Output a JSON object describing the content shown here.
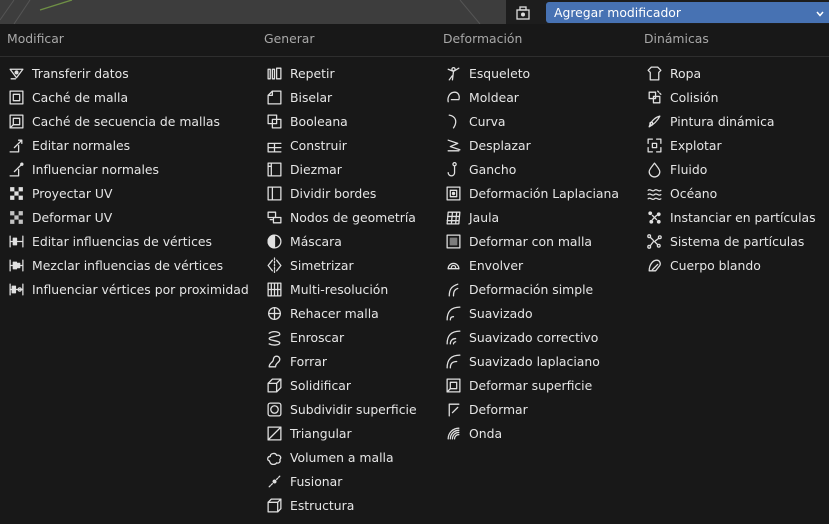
{
  "dropdown": {
    "label": "Agregar modificador"
  },
  "columns": [
    {
      "header": "Modificar",
      "items": [
        {
          "label": "Transferir datos",
          "icon": "transfer-data-icon"
        },
        {
          "label": "Caché de malla",
          "icon": "mesh-cache-icon"
        },
        {
          "label": "Caché de secuencia de mallas",
          "icon": "mesh-sequence-cache-icon"
        },
        {
          "label": "Editar normales",
          "icon": "normal-edit-icon"
        },
        {
          "label": "Influenciar normales",
          "icon": "weighted-normal-icon"
        },
        {
          "label": "Proyectar UV",
          "icon": "uv-project-icon"
        },
        {
          "label": "Deformar UV",
          "icon": "uv-warp-icon"
        },
        {
          "label": "Editar influencias de vértices",
          "icon": "vertex-weight-edit-icon"
        },
        {
          "label": "Mezclar influencias de vértices",
          "icon": "vertex-weight-mix-icon"
        },
        {
          "label": "Influenciar vértices por proximidad",
          "icon": "vertex-weight-proximity-icon"
        }
      ]
    },
    {
      "header": "Generar",
      "items": [
        {
          "label": "Repetir",
          "icon": "array-icon"
        },
        {
          "label": "Biselar",
          "icon": "bevel-icon"
        },
        {
          "label": "Booleana",
          "icon": "boolean-icon"
        },
        {
          "label": "Construir",
          "icon": "build-icon"
        },
        {
          "label": "Diezmar",
          "icon": "decimate-icon"
        },
        {
          "label": "Dividir bordes",
          "icon": "edge-split-icon"
        },
        {
          "label": "Nodos de geometría",
          "icon": "geometry-nodes-icon"
        },
        {
          "label": "Máscara",
          "icon": "mask-icon"
        },
        {
          "label": "Simetrizar",
          "icon": "mirror-icon"
        },
        {
          "label": "Multi-resolución",
          "icon": "multires-icon"
        },
        {
          "label": "Rehacer malla",
          "icon": "remesh-icon"
        },
        {
          "label": "Enroscar",
          "icon": "screw-icon"
        },
        {
          "label": "Forrar",
          "icon": "skin-icon"
        },
        {
          "label": "Solidificar",
          "icon": "solidify-icon"
        },
        {
          "label": "Subdividir superficie",
          "icon": "subsurf-icon"
        },
        {
          "label": "Triangular",
          "icon": "triangulate-icon"
        },
        {
          "label": "Volumen a malla",
          "icon": "volume-to-mesh-icon"
        },
        {
          "label": "Fusionar",
          "icon": "weld-icon"
        },
        {
          "label": "Estructura",
          "icon": "wireframe-icon"
        }
      ]
    },
    {
      "header": "Deformación",
      "items": [
        {
          "label": "Esqueleto",
          "icon": "armature-icon"
        },
        {
          "label": "Moldear",
          "icon": "cast-icon"
        },
        {
          "label": "Curva",
          "icon": "curve-icon"
        },
        {
          "label": "Desplazar",
          "icon": "displace-icon"
        },
        {
          "label": "Gancho",
          "icon": "hook-icon"
        },
        {
          "label": "Deformación Laplaciana",
          "icon": "laplacian-deform-icon"
        },
        {
          "label": "Jaula",
          "icon": "lattice-icon"
        },
        {
          "label": "Deformar con malla",
          "icon": "mesh-deform-icon"
        },
        {
          "label": "Envolver",
          "icon": "shrinkwrap-icon"
        },
        {
          "label": "Deformación simple",
          "icon": "simple-deform-icon"
        },
        {
          "label": "Suavizado",
          "icon": "smooth-icon"
        },
        {
          "label": "Suavizado correctivo",
          "icon": "corrective-smooth-icon"
        },
        {
          "label": "Suavizado laplaciano",
          "icon": "laplacian-smooth-icon"
        },
        {
          "label": "Deformar superficie",
          "icon": "surface-deform-icon"
        },
        {
          "label": "Deformar",
          "icon": "warp-icon"
        },
        {
          "label": "Onda",
          "icon": "wave-icon"
        }
      ]
    },
    {
      "header": "Dinámicas",
      "items": [
        {
          "label": "Ropa",
          "icon": "cloth-icon"
        },
        {
          "label": "Colisión",
          "icon": "collision-icon"
        },
        {
          "label": "Pintura dinámica",
          "icon": "dynamic-paint-icon"
        },
        {
          "label": "Explotar",
          "icon": "explode-icon"
        },
        {
          "label": "Fluido",
          "icon": "fluid-icon"
        },
        {
          "label": "Océano",
          "icon": "ocean-icon"
        },
        {
          "label": "Instanciar en partículas",
          "icon": "particle-instance-icon"
        },
        {
          "label": "Sistema de partículas",
          "icon": "particle-system-icon"
        },
        {
          "label": "Cuerpo blando",
          "icon": "soft-body-icon"
        }
      ]
    }
  ],
  "colors": {
    "accent": "#4772b3",
    "background": "#181818",
    "header_text": "#a8a8a8",
    "text": "#e6e6e6"
  }
}
